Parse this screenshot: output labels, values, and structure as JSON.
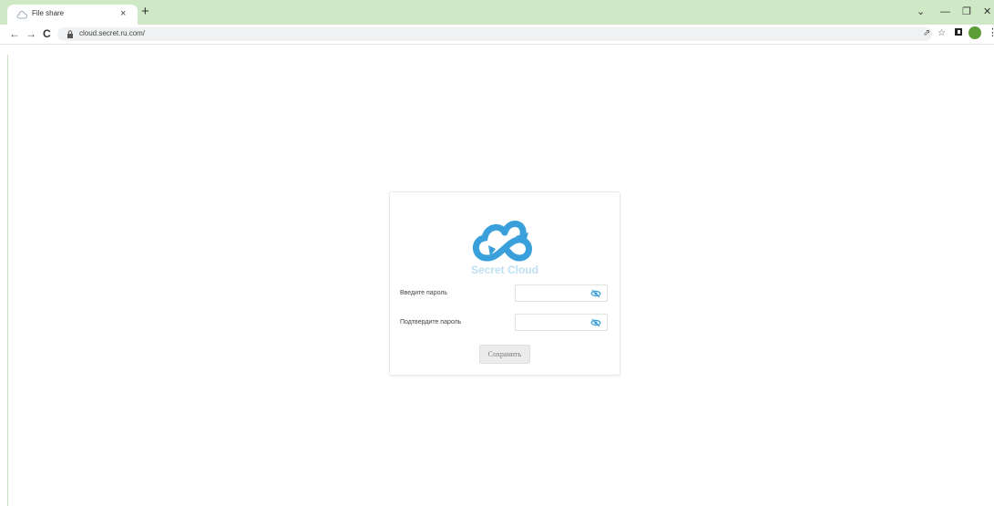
{
  "browser": {
    "tab": {
      "title": "File share",
      "close_glyph": "×",
      "favicon": "cloud-icon"
    },
    "new_tab_glyph": "+",
    "window_controls": {
      "dropdown": "⌄",
      "minimize": "—",
      "restore": "❐",
      "close": "✕"
    },
    "nav": {
      "back": "←",
      "forward": "→",
      "reload": "C"
    },
    "url": "cloud.secret.ru.com/",
    "toolbar_icons": {
      "share": "⇗",
      "bookmark": "☆",
      "menu": "⋮"
    },
    "avatar_color": "#5a9e35"
  },
  "dialog": {
    "brand": "Secret Cloud",
    "brand_color": "#3aa0dc",
    "password_label": "Введите пароль",
    "confirm_label": "Подтвердите пароль",
    "password_value": "",
    "confirm_value": "",
    "eye_icon": "eye-off-icon",
    "save_label": "Сохранить"
  }
}
